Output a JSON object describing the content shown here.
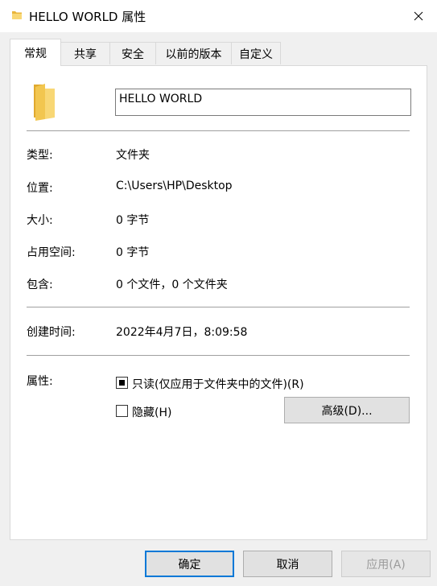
{
  "window": {
    "title": "HELLO WORLD 属性"
  },
  "tabs": [
    {
      "label": "常规",
      "active": true
    },
    {
      "label": "共享",
      "active": false
    },
    {
      "label": "安全",
      "active": false
    },
    {
      "label": "以前的版本",
      "active": false
    },
    {
      "label": "自定义",
      "active": false
    }
  ],
  "general": {
    "name": "HELLO WORLD",
    "type_label": "类型:",
    "type_value": "文件夹",
    "location_label": "位置:",
    "location_value": "C:\\Users\\HP\\Desktop",
    "size_label": "大小:",
    "size_value": "0 字节",
    "size_on_disk_label": "占用空间:",
    "size_on_disk_value": "0 字节",
    "contains_label": "包含:",
    "contains_value": "0 个文件，0 个文件夹",
    "created_label": "创建时间:",
    "created_value": "2022年4月7日，8:09:58",
    "attributes_label": "属性:",
    "readonly_label": "只读(仅应用于文件夹中的文件)(R)",
    "readonly_state": "indeterminate",
    "hidden_label": "隐藏(H)",
    "hidden_state": "unchecked",
    "advanced_button": "高级(D)..."
  },
  "footer": {
    "ok": "确定",
    "cancel": "取消",
    "apply": "应用(A)"
  },
  "colors": {
    "folder": "#f4c84a",
    "accent": "#0078d7"
  }
}
